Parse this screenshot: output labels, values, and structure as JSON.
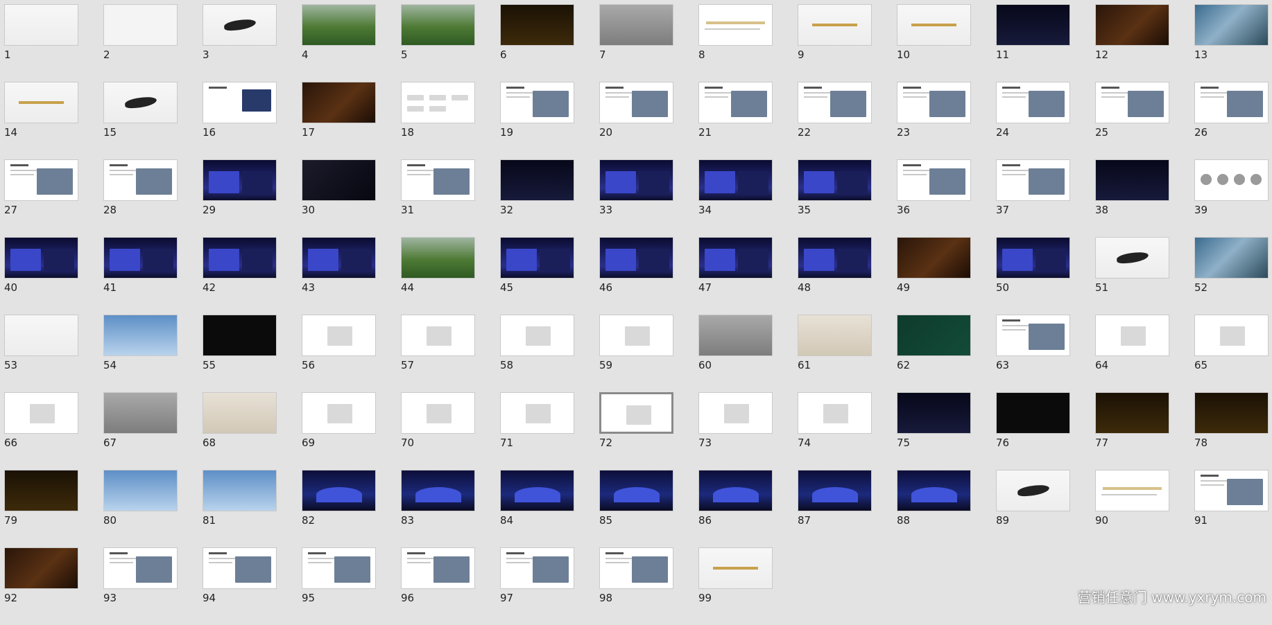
{
  "watermark": "营销任意门 www.yxrym.com",
  "selected_slide": 72,
  "slides": [
    {
      "n": "1",
      "s": "light"
    },
    {
      "n": "2",
      "s": "paper"
    },
    {
      "n": "3",
      "s": "ink"
    },
    {
      "n": "4",
      "s": "field"
    },
    {
      "n": "5",
      "s": "field"
    },
    {
      "n": "6",
      "s": "gold"
    },
    {
      "n": "7",
      "s": "gray"
    },
    {
      "n": "8",
      "s": "bars"
    },
    {
      "n": "9",
      "s": "goldtext"
    },
    {
      "n": "10",
      "s": "goldtext"
    },
    {
      "n": "11",
      "s": "night"
    },
    {
      "n": "12",
      "s": "warm"
    },
    {
      "n": "13",
      "s": "photo"
    },
    {
      "n": "14",
      "s": "goldtext"
    },
    {
      "n": "15",
      "s": "ink"
    },
    {
      "n": "16",
      "s": "photoR"
    },
    {
      "n": "17",
      "s": "warm"
    },
    {
      "n": "18",
      "s": "boxes"
    },
    {
      "n": "19",
      "s": "doc"
    },
    {
      "n": "20",
      "s": "doc"
    },
    {
      "n": "21",
      "s": "doc"
    },
    {
      "n": "22",
      "s": "doc"
    },
    {
      "n": "23",
      "s": "doc"
    },
    {
      "n": "24",
      "s": "doc"
    },
    {
      "n": "25",
      "s": "doc"
    },
    {
      "n": "26",
      "s": "doc"
    },
    {
      "n": "27",
      "s": "doc"
    },
    {
      "n": "28",
      "s": "doc"
    },
    {
      "n": "29",
      "s": "stage"
    },
    {
      "n": "30",
      "s": "dark"
    },
    {
      "n": "31",
      "s": "doc"
    },
    {
      "n": "32",
      "s": "night"
    },
    {
      "n": "33",
      "s": "stage"
    },
    {
      "n": "34",
      "s": "stage"
    },
    {
      "n": "35",
      "s": "stage"
    },
    {
      "n": "36",
      "s": "doc"
    },
    {
      "n": "37",
      "s": "doc"
    },
    {
      "n": "38",
      "s": "night"
    },
    {
      "n": "39",
      "s": "circles"
    },
    {
      "n": "40",
      "s": "stage"
    },
    {
      "n": "41",
      "s": "stage"
    },
    {
      "n": "42",
      "s": "stage"
    },
    {
      "n": "43",
      "s": "stage"
    },
    {
      "n": "44",
      "s": "field"
    },
    {
      "n": "45",
      "s": "stage"
    },
    {
      "n": "46",
      "s": "stage"
    },
    {
      "n": "47",
      "s": "stage"
    },
    {
      "n": "48",
      "s": "stage"
    },
    {
      "n": "49",
      "s": "warm"
    },
    {
      "n": "50",
      "s": "stage"
    },
    {
      "n": "51",
      "s": "ink"
    },
    {
      "n": "52",
      "s": "photo"
    },
    {
      "n": "53",
      "s": "light"
    },
    {
      "n": "54",
      "s": "sky"
    },
    {
      "n": "55",
      "s": "black"
    },
    {
      "n": "56",
      "s": "white"
    },
    {
      "n": "57",
      "s": "white"
    },
    {
      "n": "58",
      "s": "white"
    },
    {
      "n": "59",
      "s": "white"
    },
    {
      "n": "60",
      "s": "gray"
    },
    {
      "n": "61",
      "s": "beige"
    },
    {
      "n": "62",
      "s": "green"
    },
    {
      "n": "63",
      "s": "doc"
    },
    {
      "n": "64",
      "s": "white"
    },
    {
      "n": "65",
      "s": "white"
    },
    {
      "n": "66",
      "s": "white"
    },
    {
      "n": "67",
      "s": "gray"
    },
    {
      "n": "68",
      "s": "beige"
    },
    {
      "n": "69",
      "s": "white"
    },
    {
      "n": "70",
      "s": "white"
    },
    {
      "n": "71",
      "s": "white"
    },
    {
      "n": "72",
      "s": "white"
    },
    {
      "n": "73",
      "s": "white"
    },
    {
      "n": "74",
      "s": "white"
    },
    {
      "n": "75",
      "s": "night"
    },
    {
      "n": "76",
      "s": "black"
    },
    {
      "n": "77",
      "s": "gold"
    },
    {
      "n": "78",
      "s": "gold"
    },
    {
      "n": "79",
      "s": "gold"
    },
    {
      "n": "80",
      "s": "sky"
    },
    {
      "n": "81",
      "s": "sky"
    },
    {
      "n": "82",
      "s": "arena"
    },
    {
      "n": "83",
      "s": "arena"
    },
    {
      "n": "84",
      "s": "arena"
    },
    {
      "n": "85",
      "s": "arena"
    },
    {
      "n": "86",
      "s": "arena"
    },
    {
      "n": "87",
      "s": "arena"
    },
    {
      "n": "88",
      "s": "arena"
    },
    {
      "n": "89",
      "s": "ink"
    },
    {
      "n": "90",
      "s": "bars"
    },
    {
      "n": "91",
      "s": "doc"
    },
    {
      "n": "92",
      "s": "warm"
    },
    {
      "n": "93",
      "s": "doc"
    },
    {
      "n": "94",
      "s": "doc"
    },
    {
      "n": "95",
      "s": "doc"
    },
    {
      "n": "96",
      "s": "doc"
    },
    {
      "n": "97",
      "s": "doc"
    },
    {
      "n": "98",
      "s": "doc"
    },
    {
      "n": "99",
      "s": "goldtext"
    }
  ]
}
